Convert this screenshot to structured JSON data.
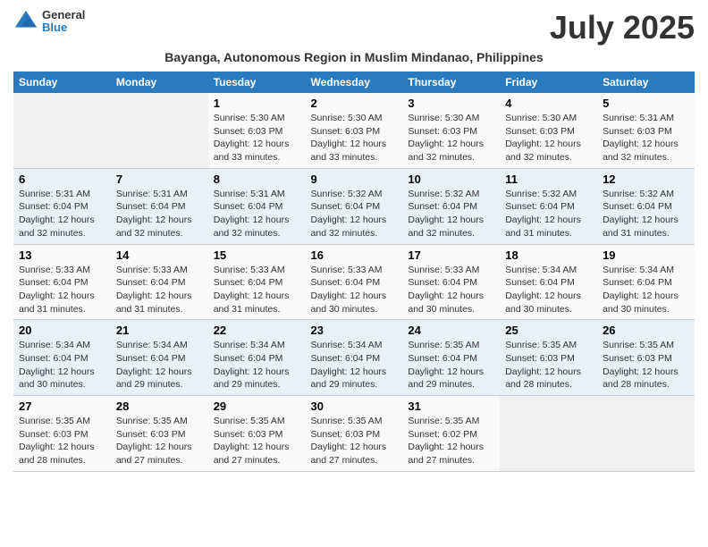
{
  "logo": {
    "line1": "General",
    "line2": "Blue"
  },
  "title": "July 2025",
  "subtitle": "Bayanga, Autonomous Region in Muslim Mindanao, Philippines",
  "weekdays": [
    "Sunday",
    "Monday",
    "Tuesday",
    "Wednesday",
    "Thursday",
    "Friday",
    "Saturday"
  ],
  "weeks": [
    [
      {
        "day": "",
        "info": ""
      },
      {
        "day": "",
        "info": ""
      },
      {
        "day": "1",
        "sunrise": "5:30 AM",
        "sunset": "6:03 PM",
        "daylight": "12 hours and 33 minutes."
      },
      {
        "day": "2",
        "sunrise": "5:30 AM",
        "sunset": "6:03 PM",
        "daylight": "12 hours and 33 minutes."
      },
      {
        "day": "3",
        "sunrise": "5:30 AM",
        "sunset": "6:03 PM",
        "daylight": "12 hours and 32 minutes."
      },
      {
        "day": "4",
        "sunrise": "5:30 AM",
        "sunset": "6:03 PM",
        "daylight": "12 hours and 32 minutes."
      },
      {
        "day": "5",
        "sunrise": "5:31 AM",
        "sunset": "6:03 PM",
        "daylight": "12 hours and 32 minutes."
      }
    ],
    [
      {
        "day": "6",
        "sunrise": "5:31 AM",
        "sunset": "6:04 PM",
        "daylight": "12 hours and 32 minutes."
      },
      {
        "day": "7",
        "sunrise": "5:31 AM",
        "sunset": "6:04 PM",
        "daylight": "12 hours and 32 minutes."
      },
      {
        "day": "8",
        "sunrise": "5:31 AM",
        "sunset": "6:04 PM",
        "daylight": "12 hours and 32 minutes."
      },
      {
        "day": "9",
        "sunrise": "5:32 AM",
        "sunset": "6:04 PM",
        "daylight": "12 hours and 32 minutes."
      },
      {
        "day": "10",
        "sunrise": "5:32 AM",
        "sunset": "6:04 PM",
        "daylight": "12 hours and 32 minutes."
      },
      {
        "day": "11",
        "sunrise": "5:32 AM",
        "sunset": "6:04 PM",
        "daylight": "12 hours and 31 minutes."
      },
      {
        "day": "12",
        "sunrise": "5:32 AM",
        "sunset": "6:04 PM",
        "daylight": "12 hours and 31 minutes."
      }
    ],
    [
      {
        "day": "13",
        "sunrise": "5:33 AM",
        "sunset": "6:04 PM",
        "daylight": "12 hours and 31 minutes."
      },
      {
        "day": "14",
        "sunrise": "5:33 AM",
        "sunset": "6:04 PM",
        "daylight": "12 hours and 31 minutes."
      },
      {
        "day": "15",
        "sunrise": "5:33 AM",
        "sunset": "6:04 PM",
        "daylight": "12 hours and 31 minutes."
      },
      {
        "day": "16",
        "sunrise": "5:33 AM",
        "sunset": "6:04 PM",
        "daylight": "12 hours and 30 minutes."
      },
      {
        "day": "17",
        "sunrise": "5:33 AM",
        "sunset": "6:04 PM",
        "daylight": "12 hours and 30 minutes."
      },
      {
        "day": "18",
        "sunrise": "5:34 AM",
        "sunset": "6:04 PM",
        "daylight": "12 hours and 30 minutes."
      },
      {
        "day": "19",
        "sunrise": "5:34 AM",
        "sunset": "6:04 PM",
        "daylight": "12 hours and 30 minutes."
      }
    ],
    [
      {
        "day": "20",
        "sunrise": "5:34 AM",
        "sunset": "6:04 PM",
        "daylight": "12 hours and 30 minutes."
      },
      {
        "day": "21",
        "sunrise": "5:34 AM",
        "sunset": "6:04 PM",
        "daylight": "12 hours and 29 minutes."
      },
      {
        "day": "22",
        "sunrise": "5:34 AM",
        "sunset": "6:04 PM",
        "daylight": "12 hours and 29 minutes."
      },
      {
        "day": "23",
        "sunrise": "5:34 AM",
        "sunset": "6:04 PM",
        "daylight": "12 hours and 29 minutes."
      },
      {
        "day": "24",
        "sunrise": "5:35 AM",
        "sunset": "6:04 PM",
        "daylight": "12 hours and 29 minutes."
      },
      {
        "day": "25",
        "sunrise": "5:35 AM",
        "sunset": "6:03 PM",
        "daylight": "12 hours and 28 minutes."
      },
      {
        "day": "26",
        "sunrise": "5:35 AM",
        "sunset": "6:03 PM",
        "daylight": "12 hours and 28 minutes."
      }
    ],
    [
      {
        "day": "27",
        "sunrise": "5:35 AM",
        "sunset": "6:03 PM",
        "daylight": "12 hours and 28 minutes."
      },
      {
        "day": "28",
        "sunrise": "5:35 AM",
        "sunset": "6:03 PM",
        "daylight": "12 hours and 27 minutes."
      },
      {
        "day": "29",
        "sunrise": "5:35 AM",
        "sunset": "6:03 PM",
        "daylight": "12 hours and 27 minutes."
      },
      {
        "day": "30",
        "sunrise": "5:35 AM",
        "sunset": "6:03 PM",
        "daylight": "12 hours and 27 minutes."
      },
      {
        "day": "31",
        "sunrise": "5:35 AM",
        "sunset": "6:02 PM",
        "daylight": "12 hours and 27 minutes."
      },
      {
        "day": "",
        "info": ""
      },
      {
        "day": "",
        "info": ""
      }
    ]
  ],
  "labels": {
    "sunrise": "Sunrise:",
    "sunset": "Sunset:",
    "daylight": "Daylight: "
  }
}
